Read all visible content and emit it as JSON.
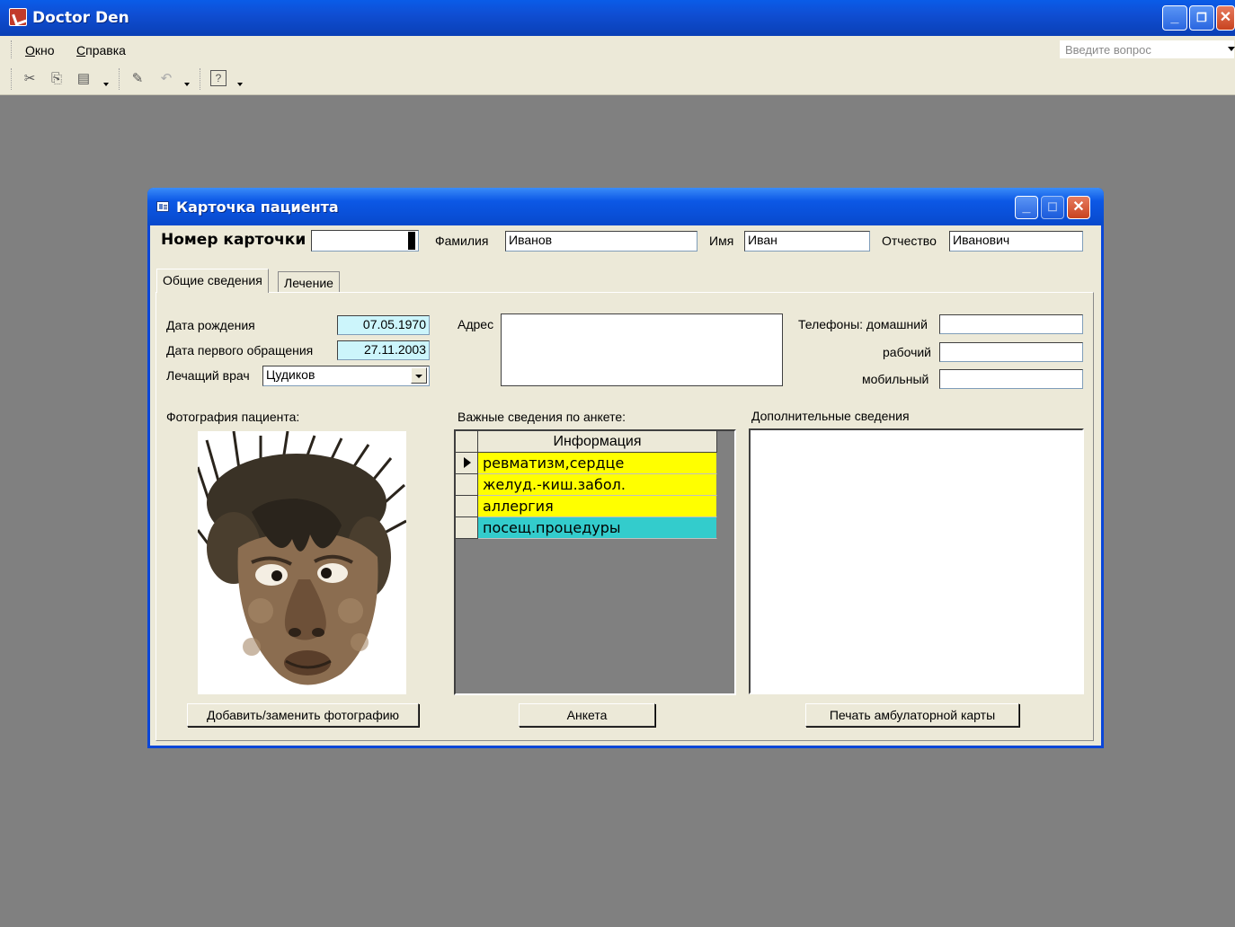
{
  "app": {
    "title": "Doctor Den",
    "menu": [
      {
        "label": "Окно",
        "underline": "О"
      },
      {
        "label": "Справка",
        "underline": "С"
      }
    ],
    "ask_placeholder": "Введите вопрос",
    "toolbar_icons": [
      "cut-icon",
      "copy-icon",
      "paste-icon",
      "format-painter-icon",
      "undo-icon",
      "help-icon"
    ]
  },
  "dialog": {
    "title": "Карточка пациента",
    "card_number_label": "Номер карточки",
    "card_number_value": "",
    "last_name_label": "Фамилия",
    "last_name_value": "Иванов",
    "first_name_label": "Имя",
    "first_name_value": "Иван",
    "patronymic_label": "Отчество",
    "patronymic_value": "Иванович",
    "tabs": [
      {
        "label": "Общие сведения",
        "active": true
      },
      {
        "label": "Лечение",
        "active": false
      }
    ],
    "general": {
      "birth_date_label": "Дата рождения",
      "birth_date_value": "07.05.1970",
      "first_visit_label": "Дата первого обращения",
      "first_visit_value": "27.11.2003",
      "doctor_label": "Лечащий врач",
      "doctor_value": "Цудиков",
      "address_label": "Адрес",
      "address_value": "",
      "phone_home_label": "Телефоны: домашний",
      "phone_work_label": "рабочий",
      "phone_mobile_label": "мобильный",
      "photo_label": "Фотография пациента:",
      "survey_label": "Важные сведения по анкете:",
      "extra_label": "Дополнительные сведения",
      "grid_header": "Информация",
      "grid_rows": [
        {
          "text": "ревматизм,сердце",
          "color": "#ffff00",
          "current": true
        },
        {
          "text": "желуд.-киш.забол.",
          "color": "#ffff00",
          "current": false
        },
        {
          "text": "аллергия",
          "color": "#ffff00",
          "current": false
        },
        {
          "text": "посещ.процедуры",
          "color": "#33cccc",
          "current": false
        }
      ],
      "photo_button": "Добавить/заменить фотографию",
      "survey_button": "Анкета",
      "print_button": "Печать амбулаторной карты"
    }
  },
  "colors": {
    "xp_blue": "#0a46d8",
    "face": "#ece9d8",
    "mdi_bg": "#808080",
    "date_field": "#ccf5fb"
  }
}
